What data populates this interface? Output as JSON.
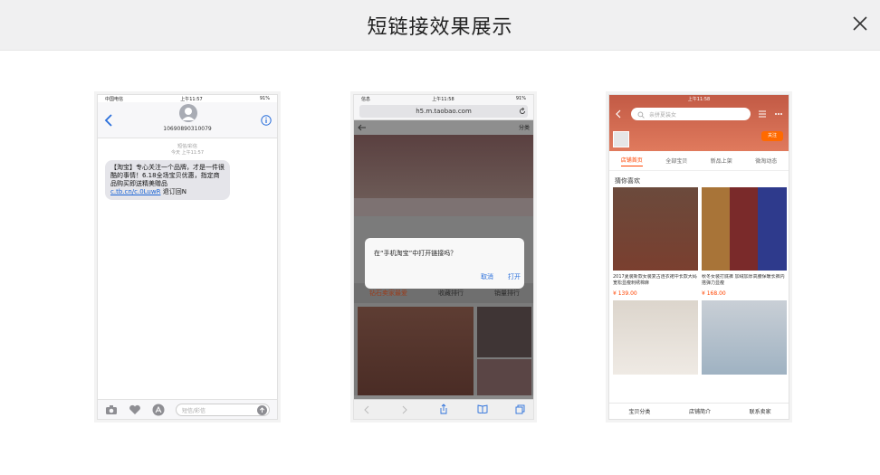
{
  "modal": {
    "title": "短链接效果展示"
  },
  "phone_sms": {
    "status_carrier": "中国电信",
    "status_time": "上午11:57",
    "status_battery": "91%",
    "sender_number": "10690890310079",
    "meta_line1": "短信/彩信",
    "meta_line2": "今天 上午11:57",
    "message_text": "【淘宝】专心关注一个品牌，才是一件很酷的事情！6.18全场宝贝优惠，指定商品购买即送精美赠品",
    "message_link": "c.tb.cn/c.0LuwR",
    "message_suffix": " 退订回N",
    "input_placeholder": "短信/彩信"
  },
  "phone_browser": {
    "status_app": "信息",
    "status_time": "上午11:58",
    "status_battery": "91%",
    "url": "h5.m.taobao.com",
    "dialog_message": "在“手机淘宝”中打开链接吗？",
    "dialog_cancel": "取消",
    "dialog_open": "打开",
    "tabs": [
      "钻石卖家最爱",
      "收藏排行",
      "销量排行"
    ],
    "category_label": "分类"
  },
  "phone_shop": {
    "status_time": "上午11:58",
    "search_placeholder": "亲拼夏装女",
    "follow_label": "关注",
    "tabs": [
      "店铺首页",
      "全部宝贝",
      "新品上架",
      "微淘动态"
    ],
    "guess_label": "猜你喜欢",
    "products": [
      {
        "title": "2017夏装新款女装复古连衣裙中长款大码宽松显瘦刺绣棉麻",
        "price": "¥ 139.00"
      },
      {
        "title": "秋冬女装打底裤 加绒加厚高腰保暖长裤内搭弹力显瘦",
        "price": "¥ 168.00"
      }
    ],
    "bottom_nav": [
      "宝贝分类",
      "店铺简介",
      "联系卖家"
    ]
  },
  "colors": {
    "accent_blue": "#2a6fdb",
    "taobao_orange": "#ff4400",
    "header_bg": "#f0f0f1"
  }
}
